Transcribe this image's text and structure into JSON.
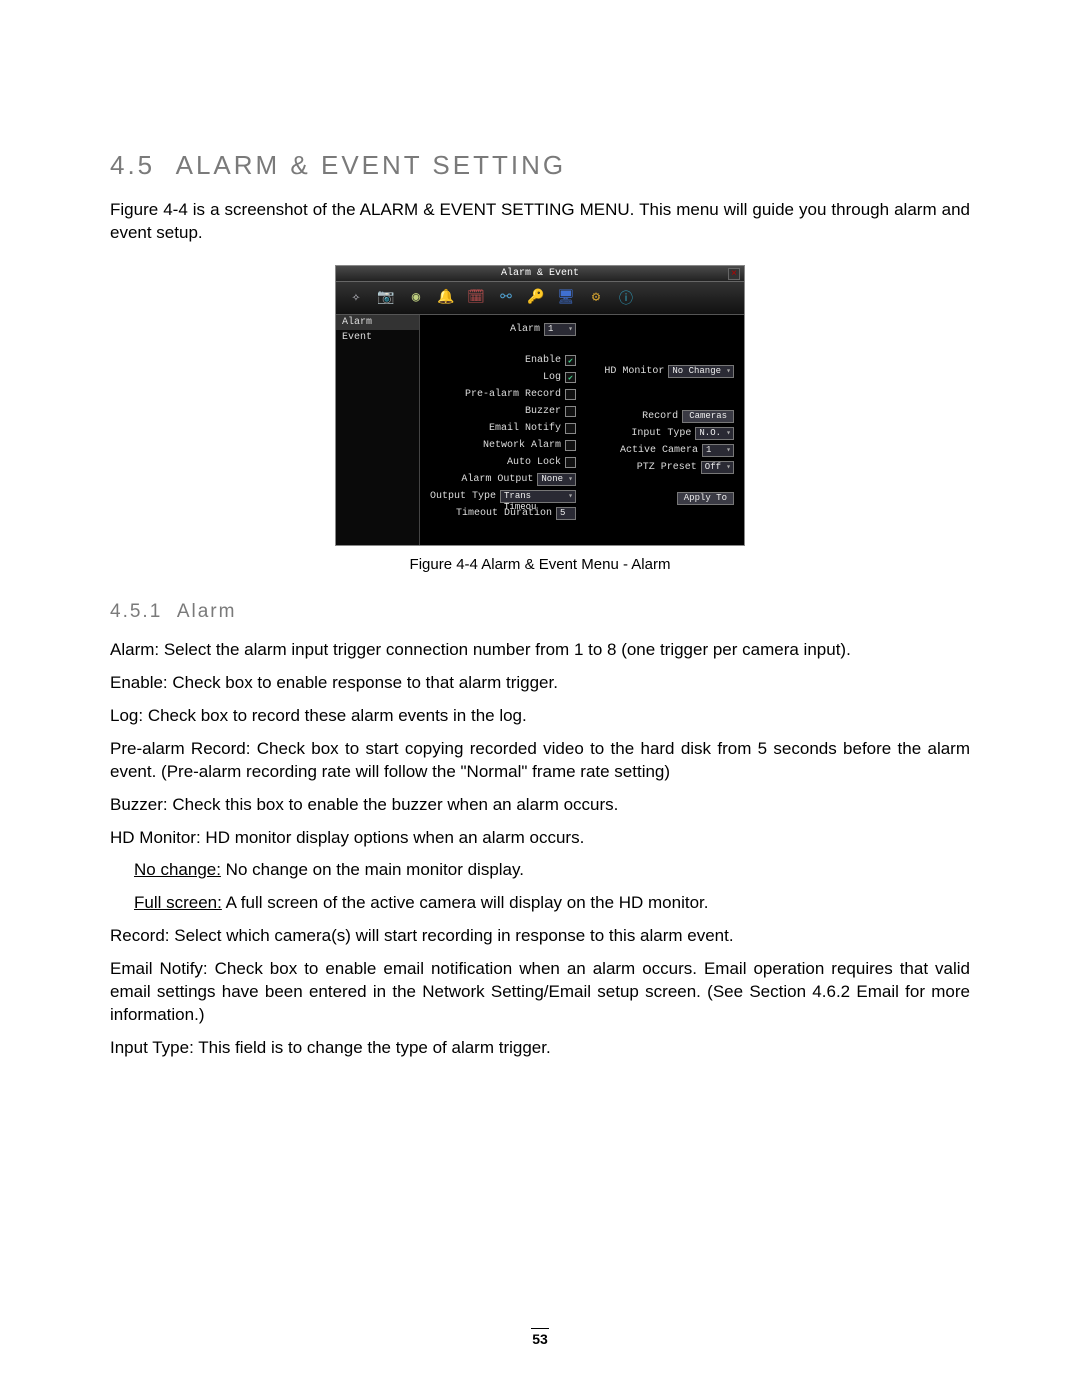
{
  "section": {
    "number": "4.5",
    "title": "ALARM & EVENT SETTING"
  },
  "intro": "Figure 4-4 is a screenshot of the ALARM & EVENT SETTING MENU. This menu will guide you through alarm and event setup.",
  "figure_caption": "Figure 4-4 Alarm & Event Menu - Alarm",
  "subsection": {
    "number": "4.5.1",
    "title": "Alarm"
  },
  "ui": {
    "title": "Alarm & Event",
    "close": "×",
    "sidebar": {
      "items": [
        "Alarm",
        "Event"
      ]
    },
    "icons": [
      "wand",
      "camera",
      "disc",
      "bell",
      "calendar",
      "network",
      "key",
      "monitor",
      "gear",
      "info"
    ],
    "form": {
      "left": [
        {
          "label": "Alarm",
          "type": "dd",
          "value": "1"
        },
        {
          "type": "spacer"
        },
        {
          "label": "Enable",
          "type": "cb",
          "checked": true
        },
        {
          "label": "Log",
          "type": "cb",
          "checked": true
        },
        {
          "label": "Pre-alarm Record",
          "type": "cb",
          "checked": false
        },
        {
          "label": "Buzzer",
          "type": "cb",
          "checked": false
        },
        {
          "label": "Email Notify",
          "type": "cb",
          "checked": false
        },
        {
          "label": "Network Alarm",
          "type": "cb",
          "checked": false
        },
        {
          "label": "Auto Lock",
          "type": "cb",
          "checked": false
        },
        {
          "label": "Alarm Output",
          "type": "dd",
          "value": "None"
        },
        {
          "label": "Output Type",
          "type": "dd",
          "value": "Trans Timeou"
        },
        {
          "label": "Timeout Duration",
          "type": "txt",
          "value": "5"
        }
      ],
      "right": [
        {
          "label": "HD Monitor",
          "type": "dd",
          "value": "No Change"
        },
        {
          "type": "spacer"
        },
        {
          "type": "spacer"
        },
        {
          "label": "Record",
          "type": "btn",
          "value": "Cameras"
        },
        {
          "label": "Input Type",
          "type": "dd",
          "value": "N.O."
        },
        {
          "label": "Active Camera",
          "type": "dd",
          "value": "1"
        },
        {
          "label": "PTZ Preset",
          "type": "dd",
          "value": "Off"
        },
        {
          "type": "spacer"
        },
        {
          "label": "",
          "type": "btn",
          "value": "Apply To"
        }
      ]
    }
  },
  "defs": {
    "alarm": {
      "lead": "Alarm:",
      "text": " Select the alarm input trigger connection number from 1 to 8 (one trigger per camera input)."
    },
    "enable": {
      "lead": "Enable:",
      "text": " Check box to enable response to that alarm trigger."
    },
    "log": {
      "lead": "Log:",
      "text": " Check box to record these alarm events in the log."
    },
    "prealarm": {
      "lead": "Pre-alarm Record:",
      "text": " Check box to start copying recorded video to the hard disk from 5 seconds before the alarm event. (Pre-alarm recording rate will follow the \"Normal\" frame rate setting)"
    },
    "buzzer": {
      "lead": "Buzzer:",
      "text": " Check this box to enable the buzzer when an alarm occurs."
    },
    "hdmon": {
      "lead": "HD Monitor:",
      "text": " HD monitor display options when an alarm occurs."
    },
    "nochange": {
      "lead": "No change:",
      "text": " No change on the main monitor display."
    },
    "fullscreen": {
      "lead": "Full screen:",
      "text": " A full screen of the active camera will display on the HD monitor."
    },
    "record": {
      "lead": "Record:",
      "text": " Select which camera(s) will start recording in response to this alarm event."
    },
    "email": {
      "lead": "Email Notify:",
      "text": " Check box to enable email notification when an alarm occurs. Email operation requires that valid email settings have been entered in the Network Setting/Email setup screen. (See Section 4.6.2 Email for more information.)"
    },
    "inputtype": {
      "lead": "Input Type:",
      "text": " This field is to change the type of alarm trigger."
    }
  },
  "page_number": "53"
}
